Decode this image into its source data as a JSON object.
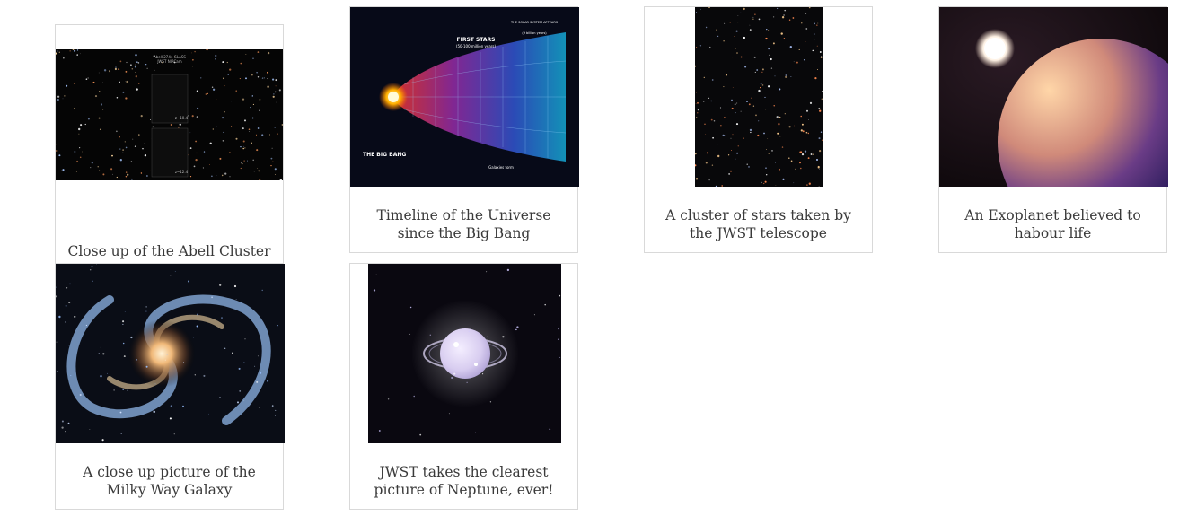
{
  "gallery": {
    "items": [
      {
        "image_subject": "Abell Cluster deep field",
        "image_texts": [
          "Abell 2744 GLASS",
          "JWST NIRCam",
          "z~10.4",
          "z~12.4"
        ],
        "caption": "Close up of the Abell Cluster"
      },
      {
        "image_subject": "Universe timeline infographic",
        "image_texts": [
          "FIRST STARS",
          "(50-100 million years)",
          "THE SOLAR SYSTEM APPEARS",
          "(9 billion years)",
          "THE BIG BANG",
          "Galaxies form"
        ],
        "caption": "Timeline of the Universe since the Big Bang"
      },
      {
        "image_subject": "JWST star field",
        "caption": "A cluster of stars taken by the JWST telescope"
      },
      {
        "image_subject": "Exoplanet with star",
        "caption": "An Exoplanet believed to habour life"
      },
      {
        "image_subject": "Spiral galaxy",
        "caption": "A close up picture of the Milky Way Galaxy"
      },
      {
        "image_subject": "Neptune with rings",
        "caption": "JWST takes the clearest picture of Neptune, ever!"
      }
    ]
  },
  "colors": {
    "card_border": "#d9d9d9",
    "caption_text": "#3a3a3a",
    "background": "#ffffff"
  }
}
